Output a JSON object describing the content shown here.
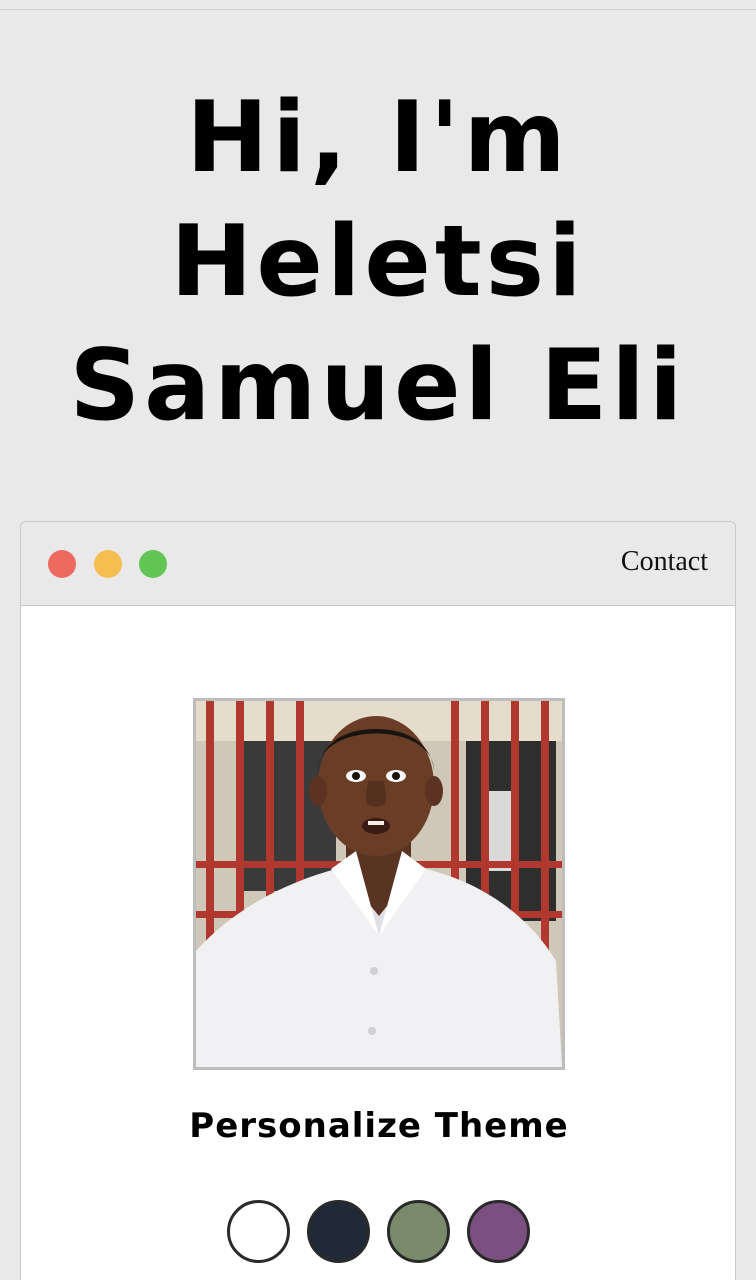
{
  "hero": {
    "line1": "Hi, I'm",
    "line2": "Heletsi",
    "line3": "Samuel Eli"
  },
  "window": {
    "controls": [
      "close",
      "minimize",
      "maximize"
    ],
    "contact_label": "Contact"
  },
  "profile": {
    "photo_icon": "profile-photo"
  },
  "theme": {
    "title": "Personalize Theme",
    "swatches": [
      "#ffffff",
      "#1f2937",
      "#7a8b6c",
      "#7b4f80"
    ]
  },
  "colors": {
    "page_bg": "#e9e9e9",
    "window_bg": "#ffffff",
    "close": "#ec6a5e",
    "minimize": "#f4bf4f",
    "maximize": "#61c554"
  }
}
